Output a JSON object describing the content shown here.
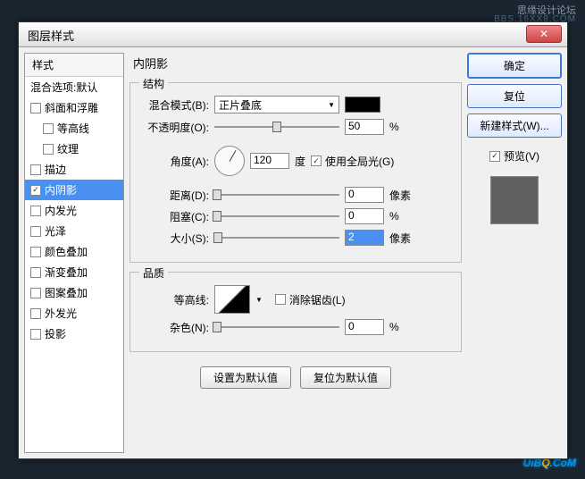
{
  "backdrop": {
    "text1": "思缘设计论坛",
    "text2": "BBS.16XX8.COM",
    "watermark_pre": "UiB",
    "watermark_Q": "Q",
    "watermark_post": ".CoM"
  },
  "dialog": {
    "title": "图层样式",
    "left": {
      "header": "样式",
      "blend_options": "混合选项:默认",
      "items": [
        {
          "label": "斜面和浮雕",
          "checked": false,
          "indent": false
        },
        {
          "label": "等高线",
          "checked": false,
          "indent": true
        },
        {
          "label": "纹理",
          "checked": false,
          "indent": true
        },
        {
          "label": "描边",
          "checked": false,
          "indent": false
        },
        {
          "label": "内阴影",
          "checked": true,
          "indent": false,
          "selected": true
        },
        {
          "label": "内发光",
          "checked": false,
          "indent": false
        },
        {
          "label": "光泽",
          "checked": false,
          "indent": false
        },
        {
          "label": "颜色叠加",
          "checked": false,
          "indent": false
        },
        {
          "label": "渐变叠加",
          "checked": false,
          "indent": false
        },
        {
          "label": "图案叠加",
          "checked": false,
          "indent": false
        },
        {
          "label": "外发光",
          "checked": false,
          "indent": false
        },
        {
          "label": "投影",
          "checked": false,
          "indent": false
        }
      ]
    },
    "center": {
      "title": "内阴影",
      "structure": {
        "legend": "结构",
        "blend_mode_label": "混合模式(B):",
        "blend_mode_value": "正片叠底",
        "opacity_label": "不透明度(O):",
        "opacity_value": "50",
        "opacity_unit": "%",
        "angle_label": "角度(A):",
        "angle_value": "120",
        "angle_unit": "度",
        "global_light": "使用全局光(G)",
        "distance_label": "距离(D):",
        "distance_value": "0",
        "distance_unit": "像素",
        "choke_label": "阻塞(C):",
        "choke_value": "0",
        "choke_unit": "%",
        "size_label": "大小(S):",
        "size_value": "2",
        "size_unit": "像素"
      },
      "quality": {
        "legend": "品质",
        "contour_label": "等高线:",
        "antialias": "消除锯齿(L)",
        "noise_label": "杂色(N):",
        "noise_value": "0",
        "noise_unit": "%"
      },
      "buttons": {
        "default": "设置为默认值",
        "reset": "复位为默认值"
      }
    },
    "right": {
      "ok": "确定",
      "cancel": "复位",
      "new_style": "新建样式(W)...",
      "preview": "预览(V)"
    }
  }
}
